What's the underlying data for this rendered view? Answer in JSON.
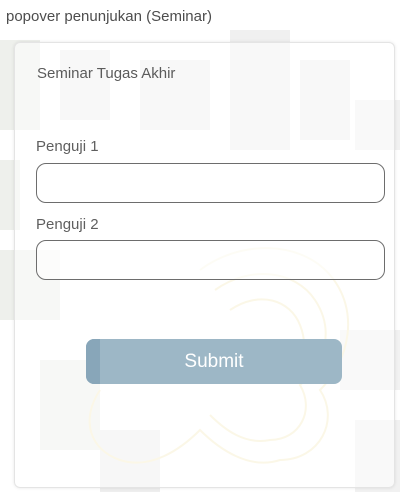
{
  "caption": "popover penunjukan (Seminar)",
  "form": {
    "title": "Seminar Tugas Akhir",
    "fields": [
      {
        "label": "Penguji 1",
        "value": "",
        "placeholder": ""
      },
      {
        "label": "Penguji 2",
        "value": "",
        "placeholder": ""
      }
    ],
    "submit_label": "Submit"
  },
  "colors": {
    "button_bg": "#9db7c6",
    "button_text": "#ffffff",
    "input_border": "#6d6d6d"
  }
}
